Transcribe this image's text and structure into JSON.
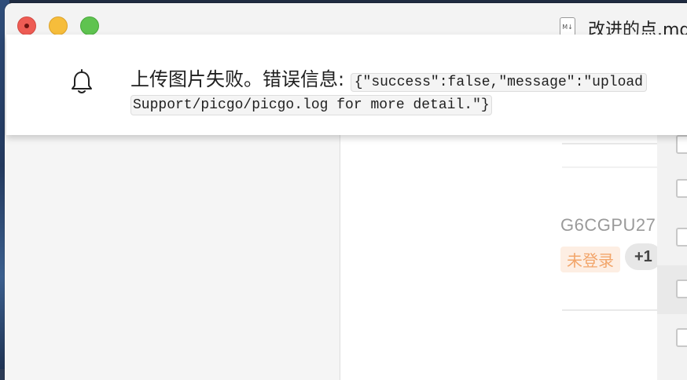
{
  "window": {
    "file_icon_label": "M↓",
    "document_title": "改进的点.md"
  },
  "notification": {
    "icon": "bell-icon",
    "prefix": "上传图片失败。错误信息: ",
    "code_line1": "{\"success\":false,\"message\":\"upload",
    "code_line2": "Support/picgo/picgo.log for more detail.\"}"
  },
  "content": {
    "partial_id": "G6CGPU27",
    "partial_login": "未登录",
    "badge": "+1"
  },
  "colors": {
    "close": "#ee5c54",
    "minimize": "#f6bd3b",
    "maximize": "#5fc350",
    "login_tag": "#f2a56a"
  }
}
